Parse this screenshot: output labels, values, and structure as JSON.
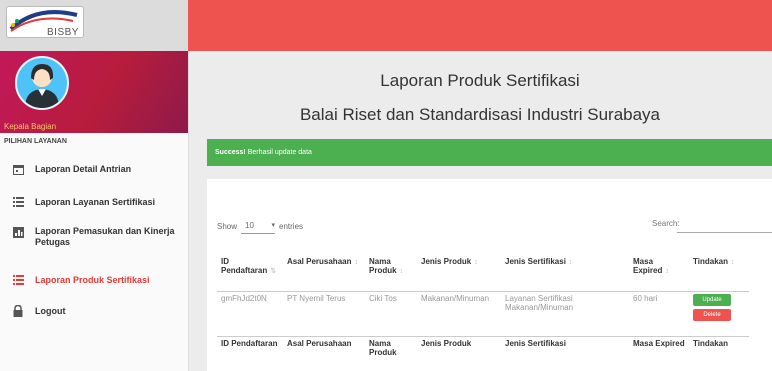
{
  "brand": {
    "logo_text": "BISBY"
  },
  "sidebar": {
    "profile_name": "Kepala Bagian",
    "section_label": "PILIHAN LAYANAN",
    "items": [
      {
        "label": "Laporan Detail Antrian",
        "icon": "calendar-icon",
        "active": false
      },
      {
        "label": "Laporan Layanan Sertifikasi",
        "icon": "list-icon",
        "active": false
      },
      {
        "label": "Laporan Pemasukan dan Kinerja Petugas",
        "icon": "chart-icon",
        "active": false
      },
      {
        "label": "Laporan Produk Sertifikasi",
        "icon": "list-icon",
        "active": true
      },
      {
        "label": "Logout",
        "icon": "lock-icon",
        "active": false
      }
    ]
  },
  "header": {
    "title": "Laporan Produk Sertifikasi",
    "subtitle": "Balai Riset dan Standardisasi Industri Surabaya"
  },
  "alert": {
    "strong": "Success!",
    "message": " Berhasil update data"
  },
  "table_controls": {
    "show_label": "Show",
    "entries_value": "10",
    "entries_label": "entries",
    "search_label": "Search:"
  },
  "table": {
    "headers": [
      "ID Pendaftaran",
      "Asal Perusahaan",
      "Nama Produk",
      "Jenis Produk",
      "Jenis Sertifikasi",
      "Masa Expired",
      "Tindakan"
    ],
    "rows": [
      {
        "id": "gmFhJd2t0N",
        "perusahaan": "PT Nyemil Terus",
        "produk": "Ciki Tos",
        "jenis_produk": "Makanan/Minuman",
        "jenis_sertifikasi": "Layanan Sertifikasi Makanan/Minuman",
        "expired": "60 hari",
        "update_label": "Update",
        "delete_label": "Delete"
      }
    ],
    "footer": [
      "ID Pendaftaran",
      "Asal Perusahaan",
      "Nama Produk",
      "Jenis Produk",
      "Jenis Sertifikasi",
      "Masa Expired",
      "Tindakan"
    ]
  },
  "colors": {
    "topbar": "#ef5350",
    "profile_bg": "#c2185b",
    "active": "#e53935",
    "success": "#4caf50",
    "danger": "#ef5350"
  }
}
